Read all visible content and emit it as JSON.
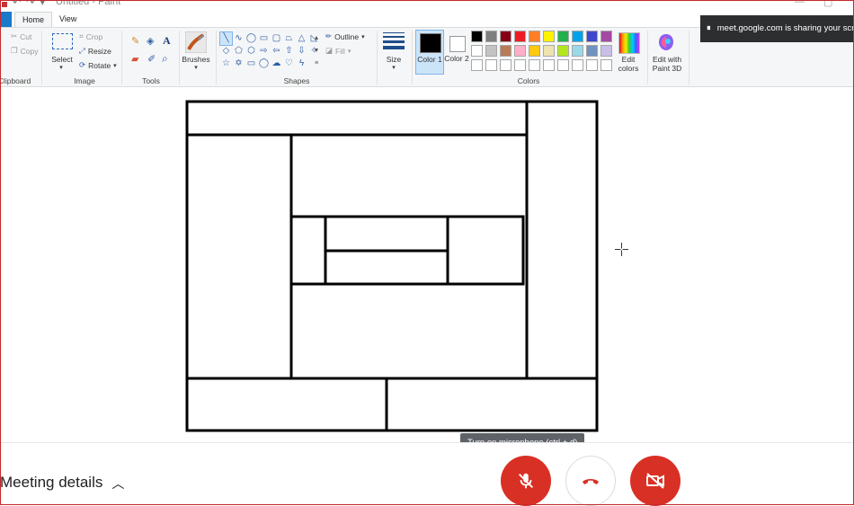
{
  "window": {
    "title": "Untitled - Paint"
  },
  "ribbon_tabs": {
    "home": "Home",
    "view": "View"
  },
  "clipboard": {
    "cut": "Cut",
    "copy": "Copy",
    "group": "Clipboard"
  },
  "image": {
    "select": "Select",
    "crop": "Crop",
    "resize": "Resize",
    "rotate": "Rotate",
    "group": "Image"
  },
  "tools": {
    "group": "Tools"
  },
  "brushes": {
    "label": "Brushes"
  },
  "shapes": {
    "outline": "Outline",
    "fill": "Fill",
    "group": "Shapes"
  },
  "size": {
    "label": "Size"
  },
  "colors": {
    "color1": "Color 1",
    "color2": "Color 2",
    "edit": "Edit colors",
    "paint3d": "Edit with Paint 3D",
    "group": "Colors",
    "palette_row1": [
      "#000000",
      "#7f7f7f",
      "#880015",
      "#ed1c24",
      "#ff7f27",
      "#fff200",
      "#22b14c",
      "#00a2e8",
      "#3f48cc",
      "#a349a4"
    ],
    "palette_row2": [
      "#ffffff",
      "#c3c3c3",
      "#b97a57",
      "#ffaec9",
      "#ffc90e",
      "#efe4b0",
      "#b5e61d",
      "#99d9ea",
      "#7092be",
      "#c8bfe7"
    ],
    "palette_row3": [
      "#ffffff",
      "#ffffff",
      "#ffffff",
      "#ffffff",
      "#ffffff",
      "#ffffff",
      "#ffffff",
      "#ffffff",
      "#ffffff",
      "#ffffff"
    ]
  },
  "share_toast": {
    "text": "meet.google.com is sharing your screen."
  },
  "meeting": {
    "details_label": "Meeting details",
    "mic_tooltip": "Turn on microphone (ctrl + d)"
  }
}
